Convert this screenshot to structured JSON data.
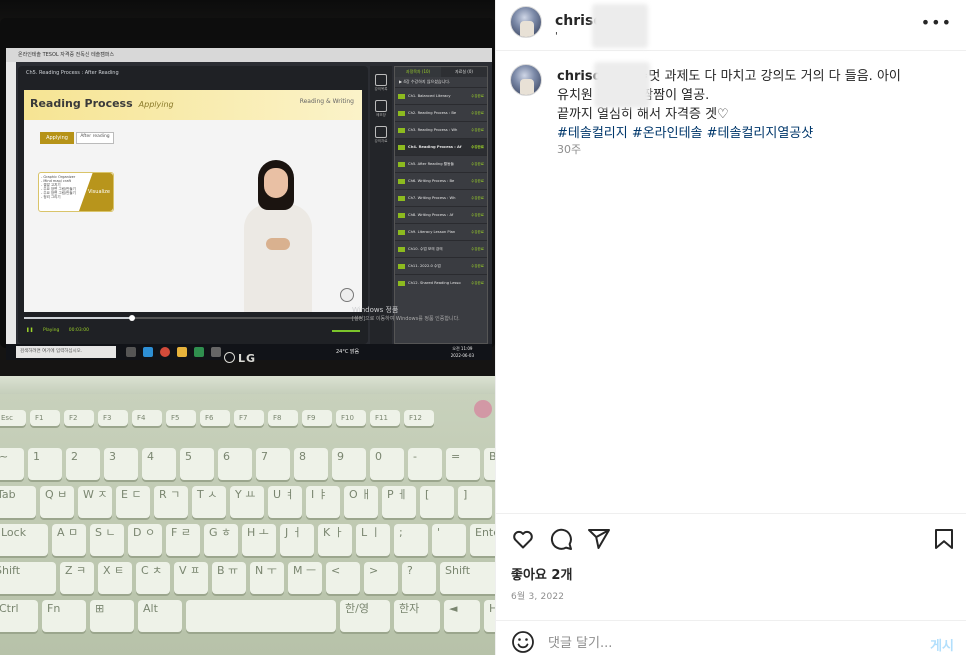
{
  "photo": {
    "window_title": "온라인테솔 TESOL 자격증 전독신 테솔캠퍼스",
    "breadcrumb": "Ch5. Reading Process : After Reading",
    "slide": {
      "title": "Reading Process",
      "subtitle": "Applying",
      "corner": "Reading & Writing",
      "tag_applying": "Applying",
      "tag_after": "After reading",
      "organizer_lines": "- Graphic Organizer\n- Mind map/ craft\n- 결말 고치기\n- 주요 장면 그림/만들기\n- 주요 장면 그림/만들기\n- 정리 그리기",
      "visualize_label": "Visualize"
    },
    "player": {
      "play_label": "Playing",
      "time": "00:03:00",
      "progress": 0.32
    },
    "side_icons": [
      "강의목록",
      "메모장",
      "강의자료"
    ],
    "toc": {
      "tab_active": "과정목차 (10)",
      "tab_other": "자료실 (0)",
      "subheader": "▶ 4강 수강하지 않으셨습니다.",
      "items": [
        {
          "name": "Ch1. Balanced Literacy",
          "status": "수강완료",
          "current": false
        },
        {
          "name": "Ch2. Reading Process : Be",
          "status": "수강완료",
          "current": false
        },
        {
          "name": "Ch3. Reading Process : Wh",
          "status": "수강완료",
          "current": false
        },
        {
          "name": "Ch4. Reading Process : Af",
          "status": "수강완료",
          "current": true
        },
        {
          "name": "Ch5. After Reading 활동들",
          "status": "수강완료",
          "current": false
        },
        {
          "name": "Ch6. Writing Process : Be",
          "status": "수강완료",
          "current": false
        },
        {
          "name": "Ch7. Writing Process : Wh",
          "status": "수강완료",
          "current": false
        },
        {
          "name": "Ch8. Writing Process : Af",
          "status": "수강완료",
          "current": false
        },
        {
          "name": "Ch9. Literacy Lesson Plan",
          "status": "수강완료",
          "current": false
        },
        {
          "name": "Ch10. 수업 모의 강의",
          "status": "수강완료",
          "current": false
        },
        {
          "name": "Ch11. 2022.0 수업",
          "status": "수강완료",
          "current": false
        },
        {
          "name": "Ch12. Shared Reading Lesso",
          "status": "수강완료",
          "current": false
        }
      ]
    },
    "watermark_title": "Windows 정품",
    "watermark_sub": "[설정]으로 이동하여 Windows를 정품 인증합니다.",
    "taskbar": {
      "search_placeholder": "검색하려면 여기에 입력하십시오.",
      "weather": "24°C 맑음",
      "time": "오전 11:09",
      "date": "2022-06-03"
    },
    "laptop_brand": "LG",
    "keyboard_rows": [
      [
        "Esc",
        "F1",
        "F2",
        "F3",
        "F4",
        "F5",
        "F6",
        "F7",
        "F8",
        "F9",
        "F10",
        "F11",
        "F12"
      ],
      [
        "~",
        "1",
        "2",
        "3",
        "4",
        "5",
        "6",
        "7",
        "8",
        "9",
        "0",
        "-",
        "=",
        "Backspace"
      ],
      [
        "Tab",
        "Q ㅂ",
        "W ㅈ",
        "E ㄷ",
        "R ㄱ",
        "T ㅅ",
        "Y ㅛ",
        "U ㅕ",
        "I ㅑ",
        "O ㅐ",
        "P ㅔ",
        "[",
        "]"
      ],
      [
        "Lock",
        "A ㅁ",
        "S ㄴ",
        "D ㅇ",
        "F ㄹ",
        "G ㅎ",
        "H ㅗ",
        "J ㅓ",
        "K ㅏ",
        "L ㅣ",
        ";",
        "'",
        "Enter"
      ],
      [
        "Shift",
        "Z ㅋ",
        "X ㅌ",
        "C ㅊ",
        "V ㅍ",
        "B ㅠ",
        "N ㅜ",
        "M ㅡ",
        "<",
        ">",
        "?",
        "Shift"
      ],
      [
        "Ctrl",
        "Fn",
        "⊞",
        "Alt",
        "",
        "한/영",
        "한자",
        "◄",
        "Home"
      ]
    ]
  },
  "post": {
    "username": "chriso",
    "caption_user": "chriso",
    "caption_lines": [
      "=멋 과제도 다 마치고 강의도 거의 다 들음. 아이",
      "유치원 간 동안 짬짬이 열공.",
      "끝까지 열심히 해서 자격증 겟♡"
    ],
    "hashtags": "#테솔컬리지 #온라인테솔 #테솔컬리지열공샷",
    "ago": "30주",
    "likes": "좋아요 2개",
    "date": "6월 3, 2022",
    "comment_placeholder": "댓글 달기...",
    "post_label": "게시",
    "icons": {
      "more": "more-icon",
      "like": "heart-icon",
      "comment": "comment-icon",
      "share": "send-icon",
      "save": "bookmark-icon",
      "emoji": "emoji-icon"
    },
    "colors": {
      "hashtag": "#00376b",
      "post_button": "#b2dffc",
      "muted": "#8e8e8e"
    }
  }
}
